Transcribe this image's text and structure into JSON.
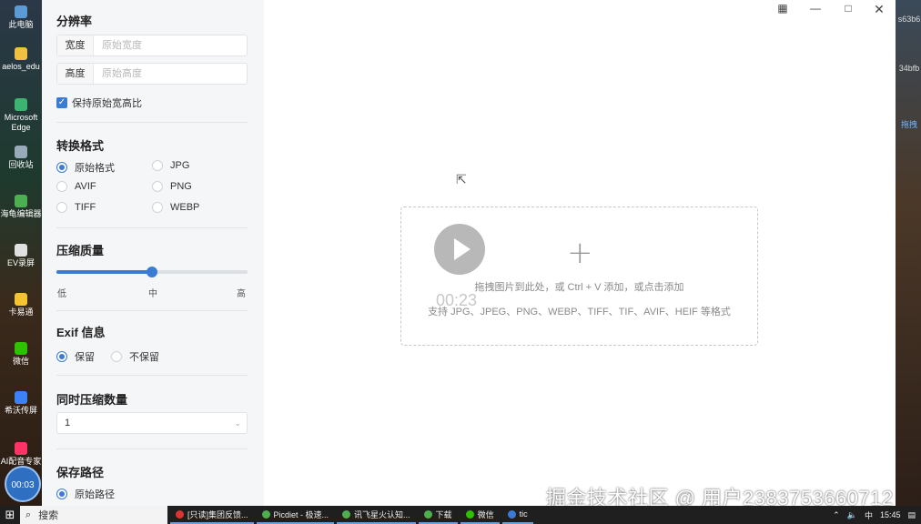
{
  "desktop": {
    "left_icons": [
      {
        "label": "此电脑",
        "color": "#5b9bd5"
      },
      {
        "label": "aelos_edu",
        "color": "#f0c040"
      },
      {
        "label": "Microsoft Edge",
        "color": "#3cb371"
      },
      {
        "label": "回收站",
        "color": "#9ab"
      },
      {
        "label": "海龟编辑器",
        "color": "#4caf50"
      },
      {
        "label": "EV录屏",
        "color": "#e0e0e0"
      },
      {
        "label": "卡易通",
        "color": "#f4c430"
      },
      {
        "label": "微信",
        "color": "#2dc100"
      },
      {
        "label": "希沃传屏",
        "color": "#3b82f6"
      },
      {
        "label": "AI配音专家",
        "color": "#ff3366"
      }
    ],
    "right_items": [
      "s63b6",
      "34bfb",
      "拖拽"
    ]
  },
  "sidebar": {
    "resolution": {
      "title": "分辨率",
      "width_label": "宽度",
      "width_placeholder": "原始宽度",
      "height_label": "高度",
      "height_placeholder": "原始高度",
      "keep_ratio_label": "保持原始宽高比"
    },
    "format": {
      "title": "转换格式",
      "options": [
        "原始格式",
        "JPG",
        "AVIF",
        "PNG",
        "TIFF",
        "WEBP"
      ],
      "selected": "原始格式"
    },
    "quality": {
      "title": "压缩质量",
      "level_fraction": 0.5,
      "low": "低",
      "mid": "中",
      "high": "高"
    },
    "exif": {
      "title": "Exif 信息",
      "keep": "保留",
      "discard": "不保留",
      "selected": "保留"
    },
    "concurrency": {
      "title": "同时压缩数量",
      "value": "1"
    },
    "save_path": {
      "title": "保存路径",
      "option": "原始路径"
    }
  },
  "main": {
    "drop_hint": "拖拽图片到此处，或 Ctrl + V 添加，或点击添加",
    "formats_hint": "支持 JPG、JPEG、PNG、WEBP、TIFF、TIF、AVIF、HEIF 等格式",
    "video_time": "00:23"
  },
  "recorder_badge": "00:03",
  "taskbar": {
    "search_label": "搜索",
    "items": [
      {
        "label": "[只读]集团反馈...",
        "color": "#d33"
      },
      {
        "label": "Picdiet - 极速...",
        "color": "#4caf50"
      },
      {
        "label": "讯飞星火认知...",
        "color": "#4caf50"
      },
      {
        "label": "下载",
        "color": "#4caf50"
      },
      {
        "label": "微信",
        "color": "#2dc100"
      },
      {
        "label": "tic",
        "color": "#3a7bd5"
      }
    ],
    "time": "15:45"
  },
  "watermark": "掘金技术社区 @ 用户2383753660712"
}
